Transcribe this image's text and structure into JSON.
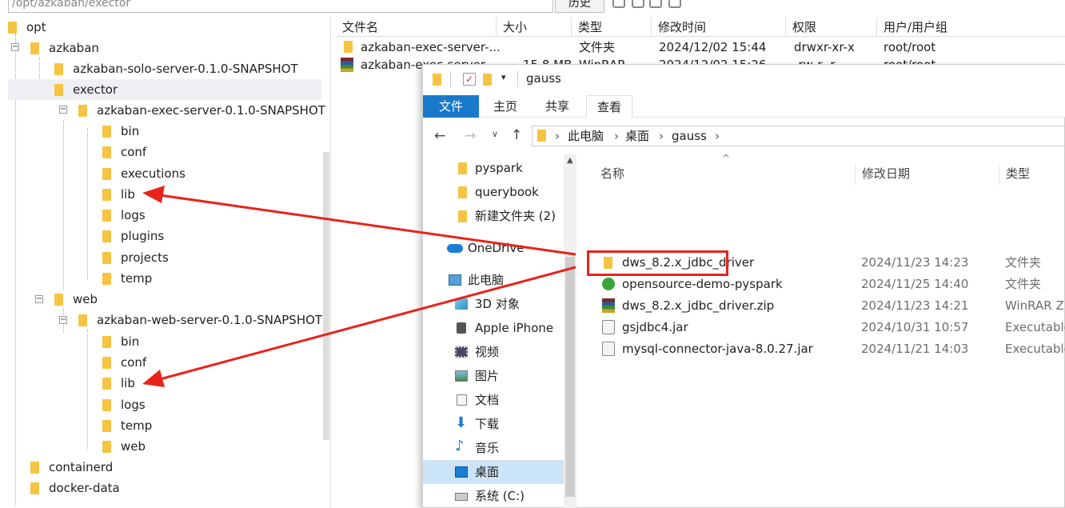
{
  "sftp": {
    "path": "/opt/azkaban/exector",
    "history_label": "历史",
    "tree": [
      {
        "label": "opt"
      },
      {
        "label": "azkaban"
      },
      {
        "label": "azkaban-solo-server-0.1.0-SNAPSHOT"
      },
      {
        "label": "exector"
      },
      {
        "label": "azkaban-exec-server-0.1.0-SNAPSHOT"
      },
      {
        "label": "bin"
      },
      {
        "label": "conf"
      },
      {
        "label": "executions"
      },
      {
        "label": "lib"
      },
      {
        "label": "logs"
      },
      {
        "label": "plugins"
      },
      {
        "label": "projects"
      },
      {
        "label": "temp"
      },
      {
        "label": "web"
      },
      {
        "label": "azkaban-web-server-0.1.0-SNAPSHOT"
      },
      {
        "label": "bin"
      },
      {
        "label": "conf"
      },
      {
        "label": "lib"
      },
      {
        "label": "logs"
      },
      {
        "label": "temp"
      },
      {
        "label": "web"
      },
      {
        "label": "containerd"
      },
      {
        "label": "docker-data"
      }
    ],
    "columns": [
      "文件名",
      "大小",
      "类型",
      "修改时间",
      "权限",
      "用户/用户组"
    ],
    "files": [
      {
        "name": "azkaban-exec-server-...",
        "size": "",
        "type": "文件夹",
        "mtime": "2024/12/02 15:44",
        "perm": "drwxr-xr-x",
        "owner": "root/root"
      },
      {
        "name": "azkaban-exec-server-...",
        "size": "15.8 MB",
        "type": "WinRAR...",
        "mtime": "2024/12/02 15:26",
        "perm": "-rw-r--r--",
        "owner": "root/root"
      }
    ]
  },
  "explorer": {
    "title": "gauss",
    "tabs": {
      "file": "文件",
      "home": "主页",
      "share": "共享",
      "view": "查看"
    },
    "breadcrumb": [
      "此电脑",
      "桌面",
      "gauss"
    ],
    "nav": [
      {
        "label": "pyspark",
        "icon": "folder-icon"
      },
      {
        "label": "querybook",
        "icon": "folder-icon"
      },
      {
        "label": "新建文件夹 (2)",
        "icon": "folder-icon"
      },
      {
        "label": "OneDrive",
        "icon": "cloud-icon"
      },
      {
        "label": "此电脑",
        "icon": "computer-icon"
      },
      {
        "label": "3D 对象",
        "icon": "cube-icon"
      },
      {
        "label": "Apple iPhone",
        "icon": "phone-icon"
      },
      {
        "label": "视频",
        "icon": "video-icon"
      },
      {
        "label": "图片",
        "icon": "picture-icon"
      },
      {
        "label": "文档",
        "icon": "document-icon"
      },
      {
        "label": "下载",
        "icon": "download-icon"
      },
      {
        "label": "音乐",
        "icon": "music-icon"
      },
      {
        "label": "桌面",
        "icon": "desktop-icon"
      },
      {
        "label": "系统 (C:)",
        "icon": "drive-icon"
      }
    ],
    "columns": {
      "name": "名称",
      "date": "修改日期",
      "type": "类型"
    },
    "files": [
      {
        "name": "dws_8.2.x_jdbc_driver",
        "date": "2024/11/23 14:23",
        "type": "文件夹"
      },
      {
        "name": "opensource-demo-pyspark",
        "date": "2024/11/25 14:40",
        "type": "文件夹"
      },
      {
        "name": "dws_8.2.x_jdbc_driver.zip",
        "date": "2024/11/23 14:21",
        "type": "WinRAR ZI"
      },
      {
        "name": "gsjdbc4.jar",
        "date": "2024/10/31 10:57",
        "type": "Executable"
      },
      {
        "name": "mysql-connector-java-8.0.27.jar",
        "date": "2024/11/21 14:03",
        "type": "Executable"
      }
    ]
  },
  "colors": {
    "accent": "#1979ca",
    "annotation": "#e8231b",
    "folder": "#f6c342"
  }
}
